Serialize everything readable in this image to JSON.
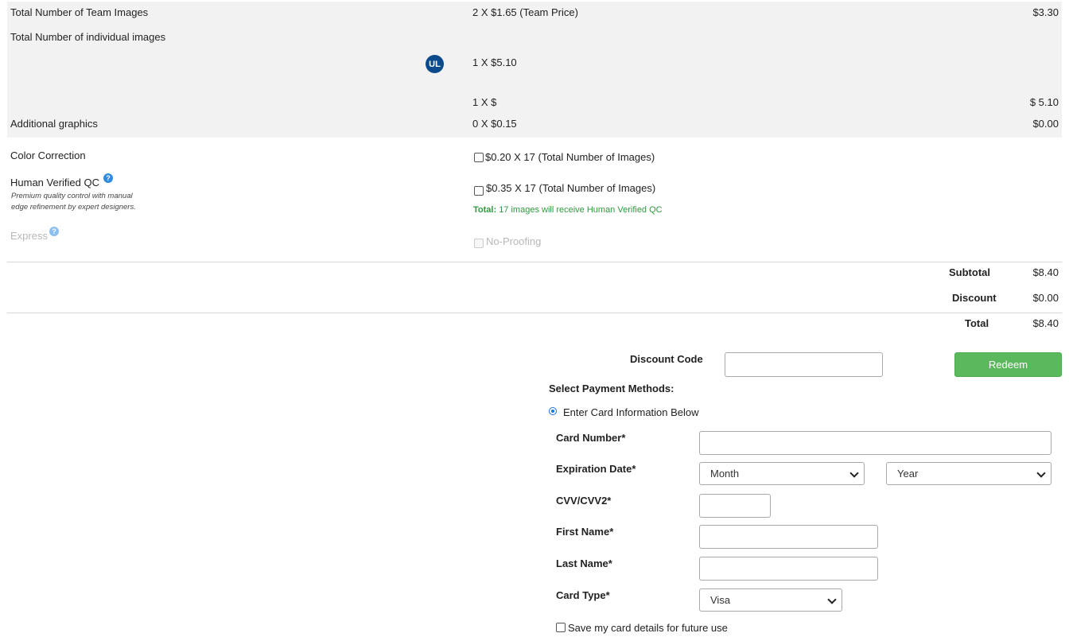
{
  "rows": {
    "team": {
      "label": "Total Number of Team Images",
      "calc": "2 X $1.65 (Team Price)",
      "amount": "$3.30"
    },
    "individual": {
      "label": "Total Number of individual images"
    },
    "individual_line1": {
      "avatar": "UL",
      "calc": "1 X $5.10"
    },
    "individual_line2": {
      "calc": "1 X $",
      "amount": "$ 5.10"
    },
    "graphics": {
      "label": "Additional graphics",
      "calc": "0 X $0.15",
      "amount": "$0.00"
    }
  },
  "options": {
    "color_correction": {
      "label": "Color Correction",
      "calc": "$0.20 X 17 (Total Number of Images)"
    },
    "hvqc": {
      "label": "Human Verified QC",
      "note_line1": "Premium quality control with manual",
      "note_line2": "edge refinement by expert designers.",
      "calc": "$0.35 X  17  (Total Number of Images)",
      "total_prefix": "Total:",
      "total_text": "17 images will receive Human Verified QC"
    },
    "express": {
      "label": "Express",
      "option": "No-Proofing"
    },
    "help_glyph": "?"
  },
  "totals": {
    "subtotal_label": "Subtotal",
    "subtotal": "$8.40",
    "discount_label": "Discount",
    "discount": "$0.00",
    "total_label": "Total",
    "total": "$8.40"
  },
  "discount_code": {
    "label": "Discount Code",
    "value": "",
    "button": "Redeem"
  },
  "payment": {
    "heading": "Select Payment Methods:",
    "method": "Enter Card Information Below",
    "card_number_label": "Card Number*",
    "expiration_label": "Expiration Date*",
    "month": "Month",
    "year": "Year",
    "cvv_label": "CVV/CVV2*",
    "first_name_label": "First Name*",
    "last_name_label": "Last Name*",
    "card_type_label": "Card Type*",
    "card_type": "Visa",
    "save_label": "Save my card details for future use"
  },
  "colors": {
    "accent_green": "#5cb85c",
    "avatar_blue": "#0c4a8c",
    "help_blue": "#2f8ae0",
    "note_green": "#2e9b3e"
  }
}
